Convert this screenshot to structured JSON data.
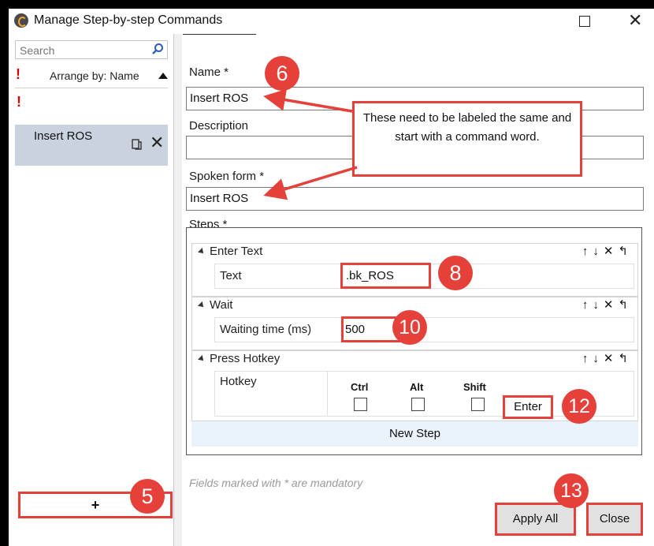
{
  "window": {
    "title": "Manage Step-by-step Commands"
  },
  "left_pane": {
    "search_placeholder": "Search",
    "arrange_label": "Arrange by: Name",
    "bang": "!",
    "command_item": "Insert ROS",
    "add_label": "+"
  },
  "form": {
    "name_label": "Name *",
    "name_value": "Insert ROS",
    "description_label": "Description",
    "description_value": "",
    "spoken_label": "Spoken form *",
    "spoken_value": "Insert ROS",
    "steps_label": "Steps *",
    "mandatory_note": "Fields marked with * are mandatory"
  },
  "steps": [
    {
      "title": "Enter Text",
      "param_label": "Text",
      "param_value": ".bk_ROS"
    },
    {
      "title": "Wait",
      "param_label": "Waiting time (ms)",
      "param_value": "500"
    },
    {
      "title": "Press Hotkey",
      "param_label": "Hotkey",
      "ctrl": "Ctrl",
      "alt": "Alt",
      "shift": "Shift",
      "key_value": "Enter"
    }
  ],
  "step_actions": "↑↓✕↰",
  "new_step_label": "New Step",
  "buttons": {
    "apply": "Apply All",
    "close": "Close"
  },
  "callout": "These need to be labeled the same and start with a command word.",
  "badges": {
    "b5": "5",
    "b6": "6",
    "b8": "8",
    "b10": "10",
    "b12": "12",
    "b13": "13"
  },
  "colors": {
    "annotation_red": "#e5413a",
    "selected_item": "#c8d3df",
    "new_step_bg": "#eaf2fb"
  }
}
